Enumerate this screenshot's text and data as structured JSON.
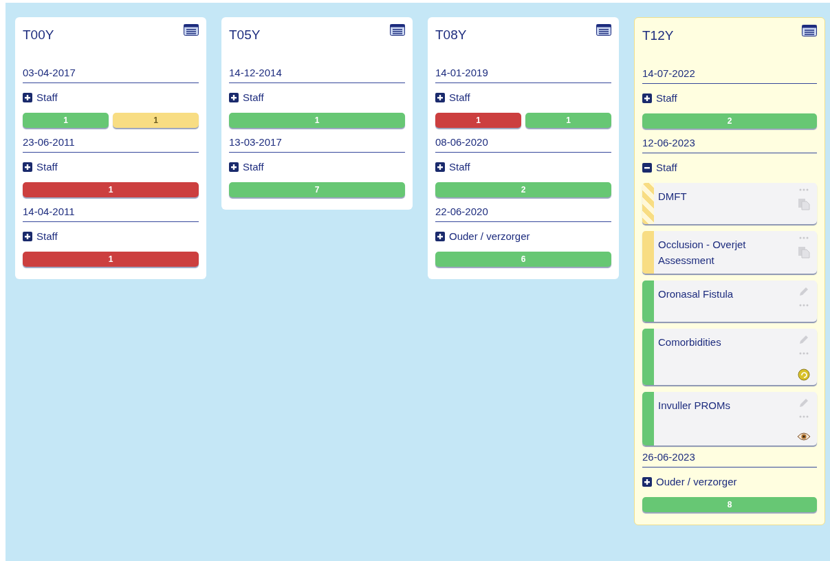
{
  "columns": [
    {
      "title": "T00Y",
      "highlighted": false,
      "sessions": [
        {
          "date": "03-04-2017",
          "group": "Staff",
          "expanded": false,
          "counts": [
            {
              "value": "1",
              "color": "#67c774"
            },
            {
              "value": "1",
              "color": "#f8dd83"
            }
          ]
        },
        {
          "date": "23-06-2011",
          "group": "Staff",
          "expanded": false,
          "counts": [
            {
              "value": "1",
              "color": "#cc3f3f"
            }
          ]
        },
        {
          "date": "14-04-2011",
          "group": "Staff",
          "expanded": false,
          "counts": [
            {
              "value": "1",
              "color": "#cc3f3f"
            }
          ]
        }
      ]
    },
    {
      "title": "T05Y",
      "highlighted": false,
      "sessions": [
        {
          "date": "14-12-2014",
          "group": "Staff",
          "expanded": false,
          "counts": [
            {
              "value": "1",
              "color": "#67c774"
            }
          ]
        },
        {
          "date": "13-03-2017",
          "group": "Staff",
          "expanded": false,
          "counts": [
            {
              "value": "7",
              "color": "#67c774"
            }
          ]
        }
      ]
    },
    {
      "title": "T08Y",
      "highlighted": false,
      "sessions": [
        {
          "date": "14-01-2019",
          "group": "Staff",
          "expanded": false,
          "counts": [
            {
              "value": "1",
              "color": "#cc3f3f"
            },
            {
              "value": "1",
              "color": "#67c774"
            }
          ]
        },
        {
          "date": "08-06-2020",
          "group": "Staff",
          "expanded": false,
          "counts": [
            {
              "value": "2",
              "color": "#67c774"
            }
          ]
        },
        {
          "date": "22-06-2020",
          "group": "Ouder / verzorger",
          "expanded": false,
          "counts": [
            {
              "value": "6",
              "color": "#67c774"
            }
          ]
        }
      ]
    },
    {
      "title": "T12Y",
      "highlighted": true,
      "sessions": [
        {
          "date": "14-07-2022",
          "group": "Staff",
          "expanded": false,
          "counts": [
            {
              "value": "2",
              "color": "#67c774"
            }
          ]
        },
        {
          "date": "12-06-2023",
          "group": "Staff",
          "expanded": true,
          "forms": [
            {
              "title": "DMFT",
              "color": "#f8dd83",
              "striped": true,
              "icons": [
                {
                  "kind": "dots"
                },
                {
                  "kind": "copy"
                }
              ]
            },
            {
              "title": "Occlusion - Overjet Assessment",
              "color": "#f8dd83",
              "striped": false,
              "icons": [
                {
                  "kind": "dots"
                },
                {
                  "kind": "copy"
                }
              ]
            },
            {
              "title": "Oronasal Fistula",
              "color": "#67c774",
              "striped": false,
              "icons": [
                {
                  "kind": "pencil"
                },
                {
                  "kind": "dots"
                }
              ]
            },
            {
              "title": "Comorbidities",
              "color": "#67c774",
              "striped": false,
              "icons": [
                {
                  "kind": "pencil"
                },
                {
                  "kind": "dots"
                },
                {
                  "kind": "refresh"
                }
              ]
            },
            {
              "title": "Invuller PROMs",
              "color": "#67c774",
              "striped": false,
              "icons": [
                {
                  "kind": "pencil"
                },
                {
                  "kind": "dots"
                },
                {
                  "kind": "eye"
                }
              ]
            }
          ]
        },
        {
          "date": "26-06-2023",
          "group": "Ouder / verzorger",
          "expanded": false,
          "counts": [
            {
              "value": "8",
              "color": "#67c774"
            }
          ]
        }
      ]
    }
  ]
}
